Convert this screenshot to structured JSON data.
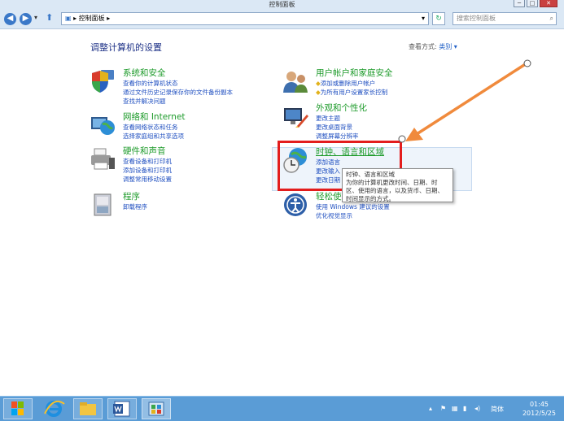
{
  "window": {
    "title": "控制面板",
    "buttons": [
      "─",
      "□",
      "✕"
    ]
  },
  "address": {
    "breadcrumb": "▸ 控制面板 ▸",
    "search_placeholder": "搜索控制面板",
    "dropdown": "▾",
    "refresh": "↻",
    "search_icon": "⌕"
  },
  "nav": {
    "back": "◀",
    "forward": "▶",
    "up": "⬆",
    "menu": "▾"
  },
  "main": {
    "heading": "调整计算机的设置",
    "view_by_label": "查看方式:",
    "view_by_value": "类别 ▾"
  },
  "categories": [
    {
      "id": "system",
      "title": "系统和安全",
      "links": [
        "查看你的计算机状态",
        "通过文件历史记录保存你的文件备份副本",
        "查找并解决问题"
      ],
      "icon": "shield-icon"
    },
    {
      "id": "network",
      "title": "网络和 Internet",
      "links": [
        "查看网络状态和任务",
        "选择家庭组和共享选项"
      ],
      "icon": "globe-network-icon"
    },
    {
      "id": "hardware",
      "title": "硬件和声音",
      "links": [
        "查看设备和打印机",
        "添加设备和打印机",
        "调整常用移动设置"
      ],
      "icon": "printer-icon"
    },
    {
      "id": "programs",
      "title": "程序",
      "links": [
        "卸载程序"
      ],
      "icon": "programs-icon"
    },
    {
      "id": "users",
      "title": "用户帐户和家庭安全",
      "links": [
        "添加或删除用户帐户",
        "为所有用户设置家长控制"
      ],
      "icon": "users-icon"
    },
    {
      "id": "appearance",
      "title": "外观和个性化",
      "links": [
        "更改主题",
        "更改桌面背景",
        "调整屏幕分辨率"
      ],
      "icon": "appearance-icon"
    },
    {
      "id": "clock",
      "title": "时钟、语言和区域",
      "links": [
        "添加语言",
        "更改输入",
        "更改日期"
      ],
      "icon": "clock-globe-icon"
    },
    {
      "id": "ease",
      "title": "轻松使用",
      "links": [
        "使用 Windows 建议的设置",
        "优化视觉显示"
      ],
      "icon": "ease-access-icon"
    }
  ],
  "tooltip": {
    "lines": [
      "时钟、语言和区域",
      "为你的计算机更改时间、日期、时",
      "区、使用的语言，以及货币、日期、",
      "时间显示的方式。"
    ]
  },
  "taskbar": {
    "tray_language": "简体",
    "time": "01:45",
    "date": "2012/5/25"
  },
  "colors": {
    "category_title": "#1e9b2b",
    "link": "#1f4fc0",
    "highlight_frame": "#e31d1d",
    "annotation_arrow": "#f08a3c"
  }
}
